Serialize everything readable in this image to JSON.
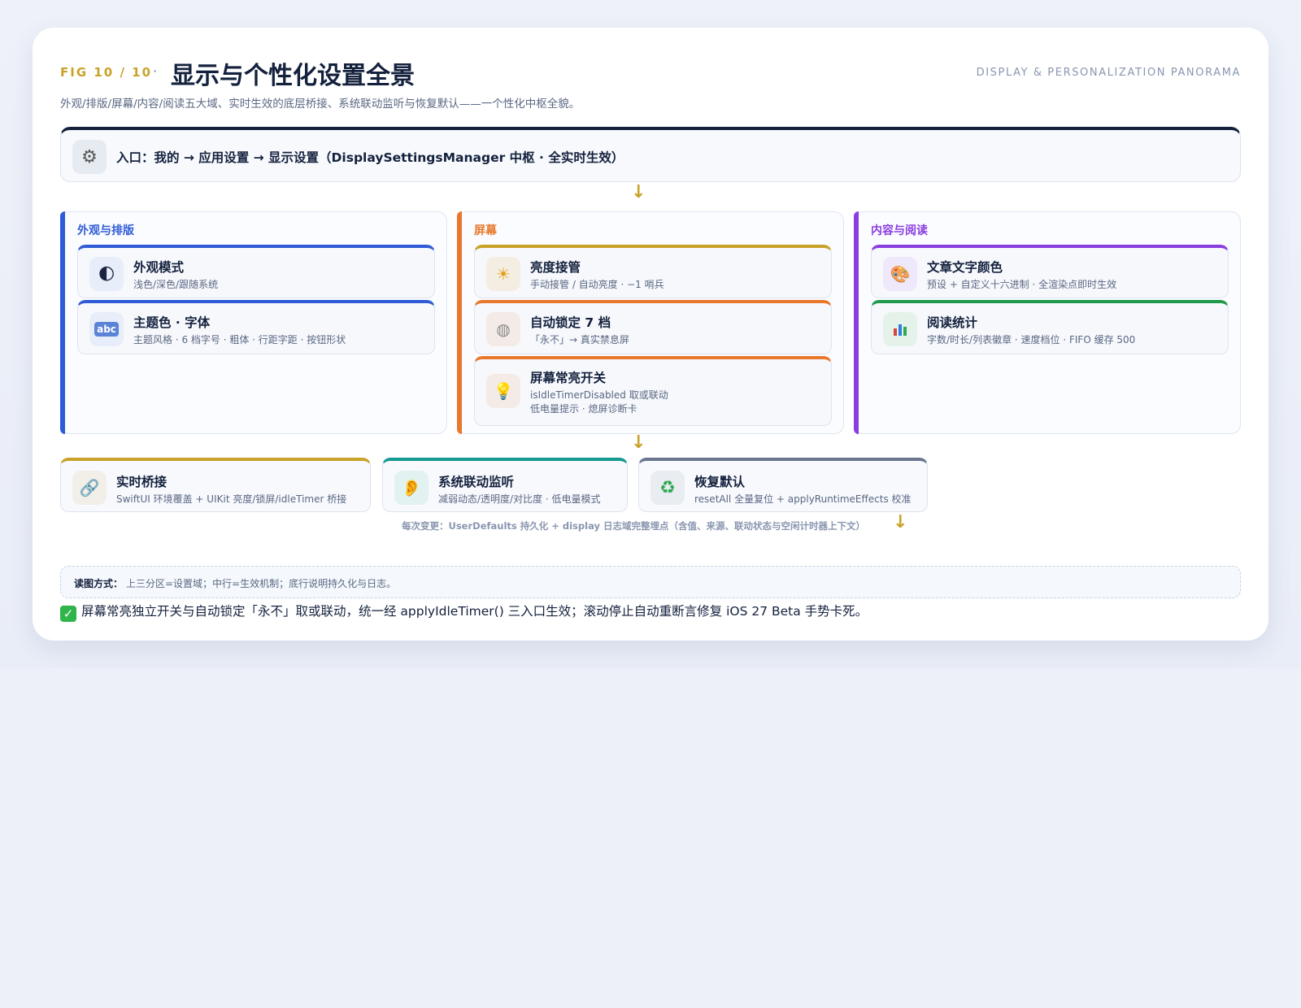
{
  "header": {
    "fig_label": "FIG 10 / 10",
    "dot": "·",
    "title": "显示与个性化设置全景",
    "english_title": "DISPLAY & PERSONALIZATION PANORAMA",
    "subtitle": "外观/排版/屏幕/内容/阅读五大域、实时生效的底层桥接、系统联动监听与恢复默认——一个性化中枢全貌。"
  },
  "entry": {
    "icon": "gear-icon",
    "text": "入口：我的 → 应用设置 → 显示设置（DisplaySettingsManager 中枢 · 全实时生效）"
  },
  "arrows": {
    "down": "↓"
  },
  "columns": [
    {
      "title": "外观与排版",
      "color": "#2f5bd6",
      "items": [
        {
          "icon": "moon-icon",
          "glyph": "🌓",
          "title": "外观模式",
          "desc": "浅色/深色/跟随系统"
        },
        {
          "icon": "abc-icon",
          "glyph": "abc",
          "title": "主题色 · 字体",
          "desc": "主题风格 · 6 档字号 · 粗体 · 行距字距 · 按钮形状"
        }
      ]
    },
    {
      "title": "屏幕",
      "color": "#e8782c",
      "items": [
        {
          "icon": "sun-icon",
          "glyph": "☀",
          "title": "亮度接管",
          "desc": "手动接管 / 自动亮度 · −1 哨兵"
        },
        {
          "icon": "lock-icon",
          "glyph": "◍",
          "title": "自动锁定 7 档",
          "desc": "「永不」→ 真实禁息屏"
        },
        {
          "icon": "bulb-icon",
          "glyph": "💡",
          "title": "屏幕常亮开关",
          "desc": "isIdleTimerDisabled 取或联动",
          "desc2": "低电量提示 · 熄屏诊断卡"
        }
      ]
    },
    {
      "title": "内容与阅读",
      "color": "#8a3ee0",
      "items": [
        {
          "icon": "palette-icon",
          "glyph": "🎨",
          "title": "文章文字颜色",
          "desc": "预设 + 自定义十六进制 · 全渲染点即时生效"
        },
        {
          "icon": "bar-chart-icon",
          "glyph": "▮",
          "title": "阅读统计",
          "desc": "字数/时长/列表徽章 · 速度档位 · FIFO 缓存 500"
        }
      ]
    }
  ],
  "mechanisms": [
    {
      "icon": "link-icon",
      "glyph": "🔗",
      "color": "#c9a22a",
      "title": "实时桥接",
      "desc": "SwiftUI 环境覆盖 + UIKit 亮度/锁屏/idleTimer 桥接"
    },
    {
      "icon": "ear-icon",
      "glyph": "👂",
      "color": "#159a8f",
      "title": "系统联动监听",
      "desc": "减弱动态/透明度/对比度 · 低电量模式"
    },
    {
      "icon": "recycle-icon",
      "glyph": "♻",
      "color": "#6b7590",
      "title": "恢复默认",
      "desc": "resetAll 全量复位 + applyRuntimeEffects 校准"
    }
  ],
  "persist_text": "每次变更：UserDefaults 持久化 + display 日志域完整埋点（含值、来源、联动状态与空闲计时器上下文）",
  "reading": {
    "key": "读图方式：",
    "value": "上三分区=设置域；中行=生效机制；底行说明持久化与日志。"
  },
  "note": {
    "icon": "checkmark-icon",
    "text": "屏幕常亮独立开关与自动锁定「永不」取或联动，统一经 applyIdleTimer() 三入口生效；滚动停止自动重断言修复 iOS 27 Beta 手势卡死。"
  }
}
